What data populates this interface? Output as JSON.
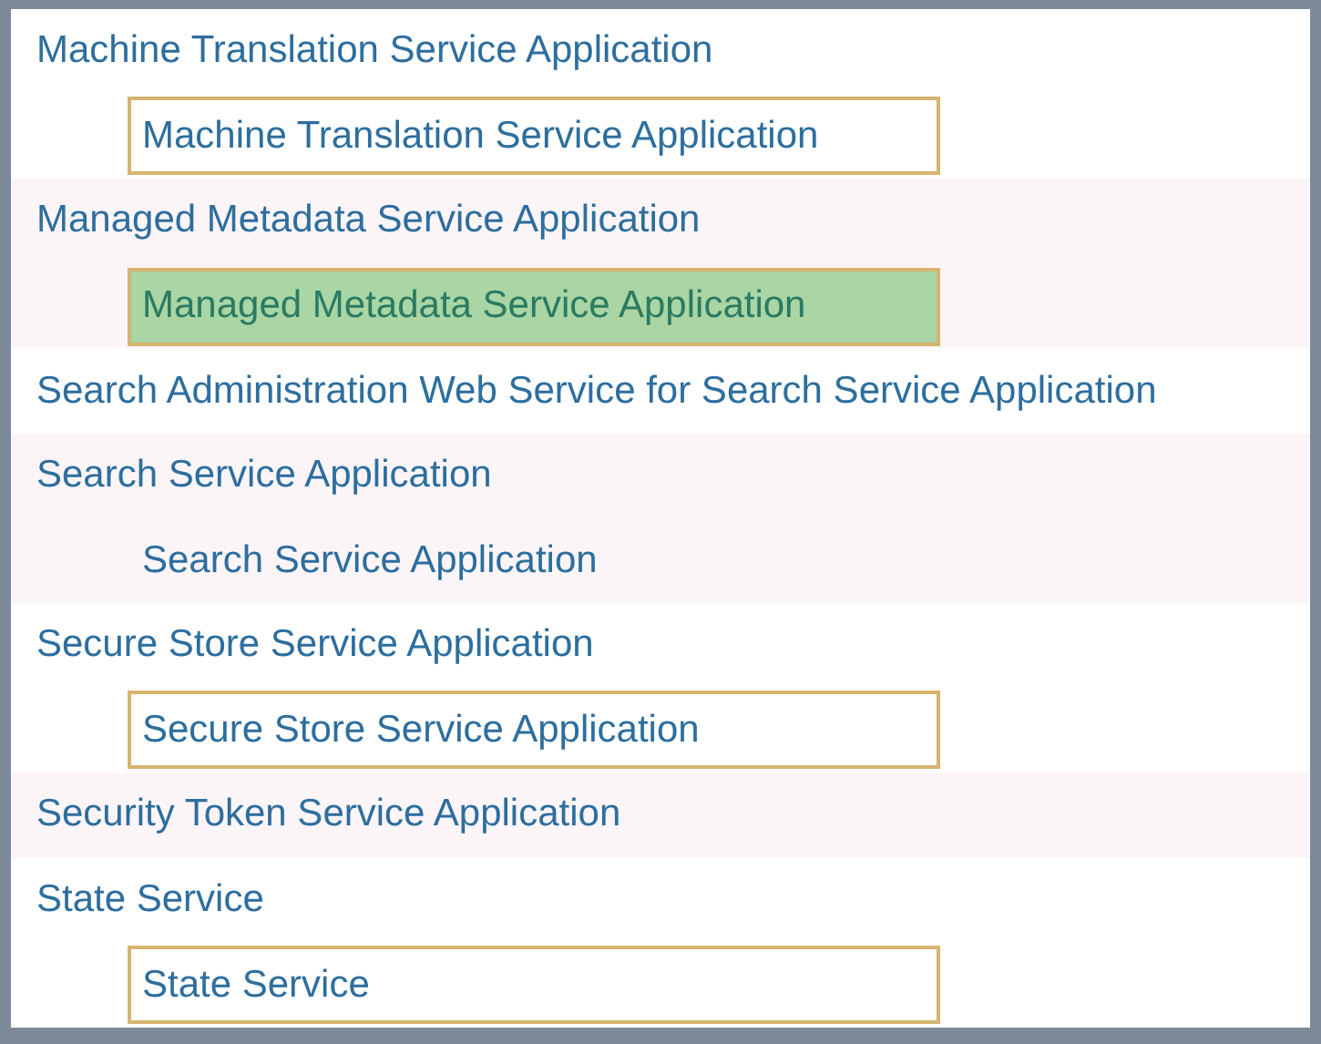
{
  "services": [
    {
      "name": "Machine Translation Service Application",
      "instance": {
        "name": "Machine Translation Service Application",
        "kind": "boxed",
        "selected": false
      }
    },
    {
      "name": "Managed Metadata Service Application",
      "instance": {
        "name": "Managed Metadata Service Application",
        "kind": "boxed",
        "selected": true
      }
    },
    {
      "name": "Search Administration Web Service for Search Service Application"
    },
    {
      "name": "Search Service Application",
      "instance": {
        "name": "Search Service Application",
        "kind": "plain",
        "selected": false
      }
    },
    {
      "name": "Secure Store Service Application",
      "instance": {
        "name": "Secure Store Service Application",
        "kind": "boxed",
        "selected": false
      }
    },
    {
      "name": "Security Token Service Application"
    },
    {
      "name": "State Service",
      "instance": {
        "name": "State Service",
        "kind": "boxed",
        "selected": false
      }
    }
  ]
}
